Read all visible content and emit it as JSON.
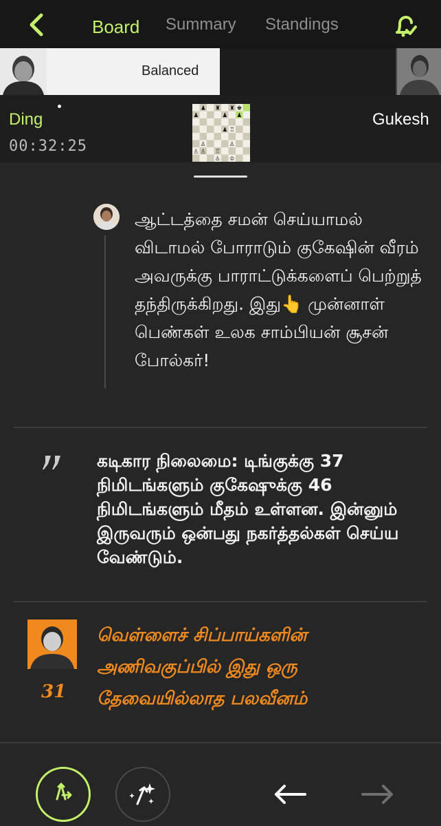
{
  "nav": {
    "tabs": [
      {
        "label": "Board",
        "active": true
      },
      {
        "label": "Summary",
        "active": false
      },
      {
        "label": "Standings",
        "active": false
      }
    ],
    "icons": {
      "back": "chevron-left-icon",
      "notify": "bell-check-icon"
    },
    "accent": "#c4f06a"
  },
  "balance": {
    "label": "Balanced"
  },
  "players": {
    "white": {
      "name": "Ding",
      "clock": "00:32:25"
    },
    "black": {
      "name": "Gukesh"
    }
  },
  "feed": {
    "comment": {
      "text": "ஆட்டத்தை சமன் செய்யாமல் விடாமல் போராடும் குகேஷின் வீரம் அவருக்கு பாராட்டுக்களைப் பெற்றுத் தந்திருக்கிறது. இது👆 முன்னாள் பெண்கள் உலக சாம்பியன் சூசன் போல்கர்!"
    },
    "note": {
      "text": "கடிகார நிலைமை: டிங்குக்கு 37 நிமிடங்களும் குகேஷுக்கு 46 நிமிடங்களும் மீதம் உள்ளன. இன்னும் இருவரும் ஒன்பது நகர்த்தல்கள் செய்ய வேண்டும்."
    },
    "move": {
      "number": "31",
      "text": "வெள்ளைச் சிப்பாய்களின் அணிவகுப்பில் இது ஒரு தேவையில்லாத பலவீனம்",
      "color": "#f08a1f"
    }
  },
  "bottom": {
    "icons": [
      "moves-icon",
      "magic-sparkle-icon",
      "arrow-left-icon",
      "arrow-right-icon"
    ]
  }
}
